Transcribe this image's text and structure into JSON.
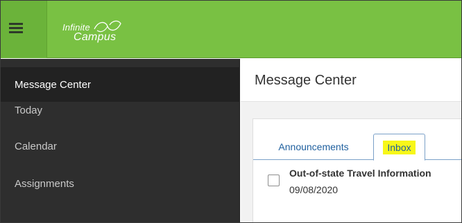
{
  "header": {
    "logo_line1": "Infinite",
    "logo_line2": "Campus",
    "bar_color": "#79c143"
  },
  "sidebar": {
    "items": [
      {
        "label": "Message Center",
        "active": true
      },
      {
        "label": "Today",
        "active": false
      },
      {
        "label": "Calendar",
        "active": false
      },
      {
        "label": "Assignments",
        "active": false
      }
    ]
  },
  "main": {
    "title": "Message Center",
    "tabs": [
      {
        "label": "Announcements",
        "active": false
      },
      {
        "label": "Inbox",
        "active": true,
        "highlight": "#f7f719"
      }
    ],
    "messages": [
      {
        "title": "Out-of-state Travel Information",
        "date": "09/08/2020",
        "checked": false
      }
    ]
  },
  "icons": {
    "menu": "hamburger-icon",
    "logo": "infinite-campus-logo"
  }
}
